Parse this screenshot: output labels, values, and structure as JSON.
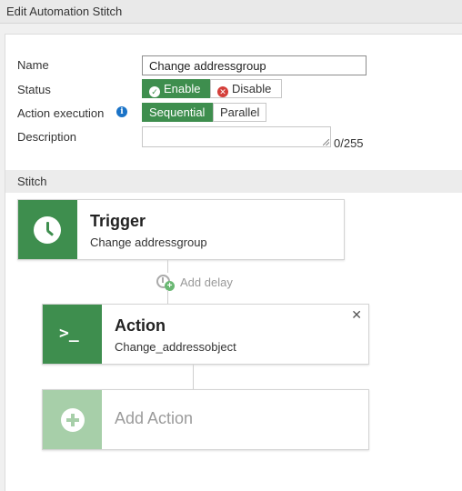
{
  "header": {
    "title": "Edit Automation Stitch"
  },
  "form": {
    "name_label": "Name",
    "name_value": "Change addressgroup",
    "status_label": "Status",
    "status_options": [
      "Enable",
      "Disable"
    ],
    "status_selected": "Enable",
    "action_execution_label": "Action execution",
    "action_execution_options": [
      "Sequential",
      "Parallel"
    ],
    "action_execution_selected": "Sequential",
    "description_label": "Description",
    "description_value": "",
    "description_count": "0/255"
  },
  "stitch": {
    "section_title": "Stitch",
    "trigger": {
      "title": "Trigger",
      "subtitle": "Change addressgroup",
      "icon": "clock-icon"
    },
    "add_delay_label": "Add delay",
    "action": {
      "title": "Action",
      "subtitle": "Change_addressobject",
      "icon": "terminal-icon"
    },
    "add_action_label": "Add Action"
  },
  "colors": {
    "accent": "#3e8e4e",
    "accent_light": "#a7cfa9",
    "danger": "#d43f3a",
    "info": "#1a73c7"
  }
}
